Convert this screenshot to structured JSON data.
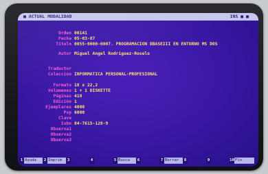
{
  "titlebar": {
    "left": "■ ACTUAL MODALIDAD",
    "right": "INS ■ ■"
  },
  "record": {
    "fields": [
      {
        "label": "Orden",
        "value": "00141"
      },
      {
        "label": "Fecha",
        "value": "05-03-87"
      },
      {
        "label": "Título",
        "value": "0055-0000-0007. PROGRAMACION DBASEIII EN ENTORNO MS DOS"
      },
      {
        "label": "Autor",
        "value": "Miguel Angel Rodriguez-Roselo"
      },
      {
        "label": "Traductor",
        "value": ""
      },
      {
        "label": "Colección",
        "value": "INFORMATICA PERSONAL-PROFESIONAL"
      },
      {
        "label": "Formato",
        "value": "18 x 22,2"
      },
      {
        "label": "Volumenes",
        "value": "1 + 1 DISKETTE"
      },
      {
        "label": "Páginas",
        "value": "418"
      },
      {
        "label": "Edición",
        "value": "1"
      },
      {
        "label": "Ejemplares",
        "value": "4000"
      },
      {
        "label": "Pvp",
        "value": "6000"
      },
      {
        "label": "Clave",
        "value": ""
      },
      {
        "label": "Isbn",
        "value": "84-7615-128-9"
      },
      {
        "label": "Observa1",
        "value": ""
      },
      {
        "label": "Observa2",
        "value": ""
      },
      {
        "label": "Observa3",
        "value": ""
      }
    ]
  },
  "fkeys": [
    {
      "num": "1",
      "label": "Ayuda"
    },
    {
      "num": "2",
      "label": "Imprim"
    },
    {
      "num": "3",
      "label": ""
    },
    {
      "num": "4",
      "label": ""
    },
    {
      "num": "5",
      "label": "Busca"
    },
    {
      "num": "6",
      "label": ""
    },
    {
      "num": "7",
      "label": "Borrar"
    },
    {
      "num": "8",
      "label": ""
    },
    {
      "num": "9",
      "label": ""
    },
    {
      "num": "10",
      "label": "Fin"
    }
  ]
}
